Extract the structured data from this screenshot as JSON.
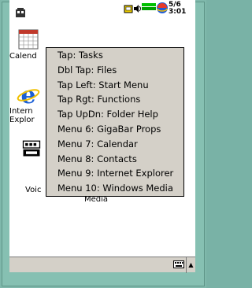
{
  "status": {
    "clock_line1": "5/6",
    "clock_line2": "3:01"
  },
  "desktop": {
    "icons": [
      {
        "label": "Calend",
        "icon": "calendar-icon"
      },
      {
        "label": "Intern",
        "label2": "Explor",
        "icon": "internet-explorer-icon"
      },
      {
        "label": "Voic",
        "icon": "voice-recorder-icon"
      },
      {
        "label": "Media",
        "icon": "windows-media-icon"
      }
    ]
  },
  "menu": {
    "items": [
      "Tap: Tasks",
      "Dbl Tap: Files",
      "Tap Left: Start Menu",
      "Tap Rgt: Functions",
      "Tap UpDn: Folder Help",
      "Menu 6: GigaBar Props",
      "Menu 7: Calendar",
      "Menu 8: Contacts",
      "Menu 9: Internet Explorer",
      "Menu 10: Windows Media"
    ]
  },
  "colors": {
    "frame": "#7fb8ab",
    "menu_bg": "#d4d0c8",
    "bar_bg": "#d4d0c8"
  }
}
